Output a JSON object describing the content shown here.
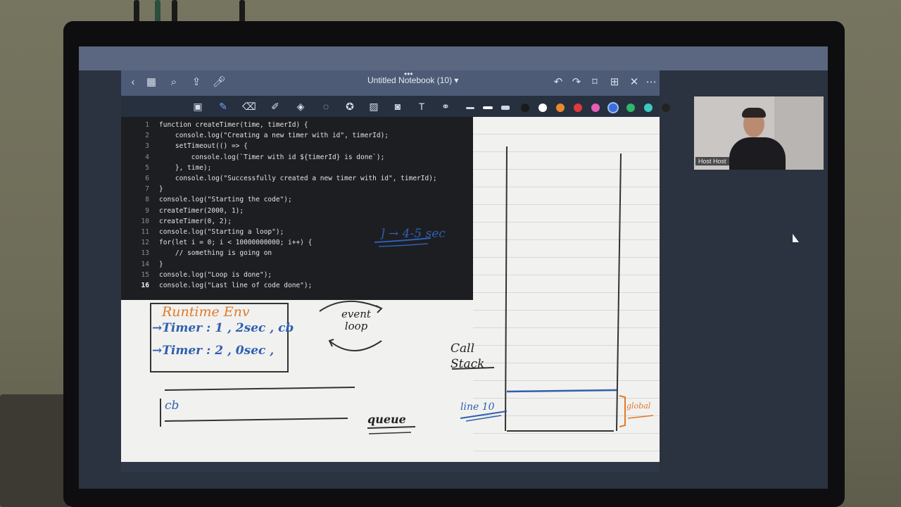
{
  "app": {
    "title": "Untitled Notebook (10)",
    "title_caret": "▾"
  },
  "icons": {
    "top_left": [
      "back-icon",
      "grid-icon",
      "search-icon",
      "share-icon",
      "mic-icon"
    ],
    "top_right": [
      "undo-icon",
      "redo-icon",
      "bookmark-icon",
      "add-page-icon",
      "close-icon",
      "more-icon"
    ],
    "toolbar": [
      "image-icon",
      "pen-icon",
      "eraser-icon",
      "highlighter-icon",
      "shapes-icon",
      "lasso-icon",
      "star-icon",
      "photo-icon",
      "camera-icon",
      "text-icon",
      "link-icon"
    ]
  },
  "colors": {
    "swatches": [
      "#1a1a1a",
      "#ffffff",
      "#e9882f",
      "#e03a3a",
      "#e85db5",
      "#3a6fd8",
      "#2fb86a",
      "#3cc9c2",
      "#222222"
    ],
    "handwriting_orange": "#e07a2c",
    "handwriting_blue": "#2f5fb0"
  },
  "code": {
    "lines": [
      {
        "n": "1",
        "text": "function createTimer(time, timerId) {"
      },
      {
        "n": "2",
        "text": "    console.log(\"Creating a new timer with id\", timerId);"
      },
      {
        "n": "3",
        "text": "    setTimeout(() => {"
      },
      {
        "n": "4",
        "text": "        console.log(`Timer with id ${timerId} is done`);"
      },
      {
        "n": "5",
        "text": "    }, time);"
      },
      {
        "n": "6",
        "text": "    console.log(\"Successfully created a new timer with id\", timerId);"
      },
      {
        "n": "7",
        "text": "}"
      },
      {
        "n": "8",
        "text": "console.log(\"Starting the code\");"
      },
      {
        "n": "9",
        "text": "createTimer(2000, 1);"
      },
      {
        "n": "10",
        "text": "createTimer(0, 2);"
      },
      {
        "n": "11",
        "text": "console.log(\"Starting a loop\");"
      },
      {
        "n": "12",
        "text": "for(let i = 0; i < 10000000000; i++) {"
      },
      {
        "n": "13",
        "text": "    // something is going on"
      },
      {
        "n": "14",
        "text": "}"
      },
      {
        "n": "15",
        "text": "console.log(\"Loop is done\");"
      },
      {
        "n": "16",
        "text": "console.log(\"Last line of code done\");"
      }
    ]
  },
  "notes": {
    "loop_annotation": "] → 4-5 sec",
    "runtime_title": "Runtime Env",
    "timer1": "→Timer : 1 , 2sec , cb",
    "timer2": "→Timer : 2 , 0sec ,",
    "event_loop": "event loop",
    "call_stack": "Call Stack",
    "queue_cb": "cb",
    "queue_label": "queue",
    "stack_item": "line 10",
    "global_label": "global"
  },
  "webcam": {
    "name": "Host Host"
  }
}
